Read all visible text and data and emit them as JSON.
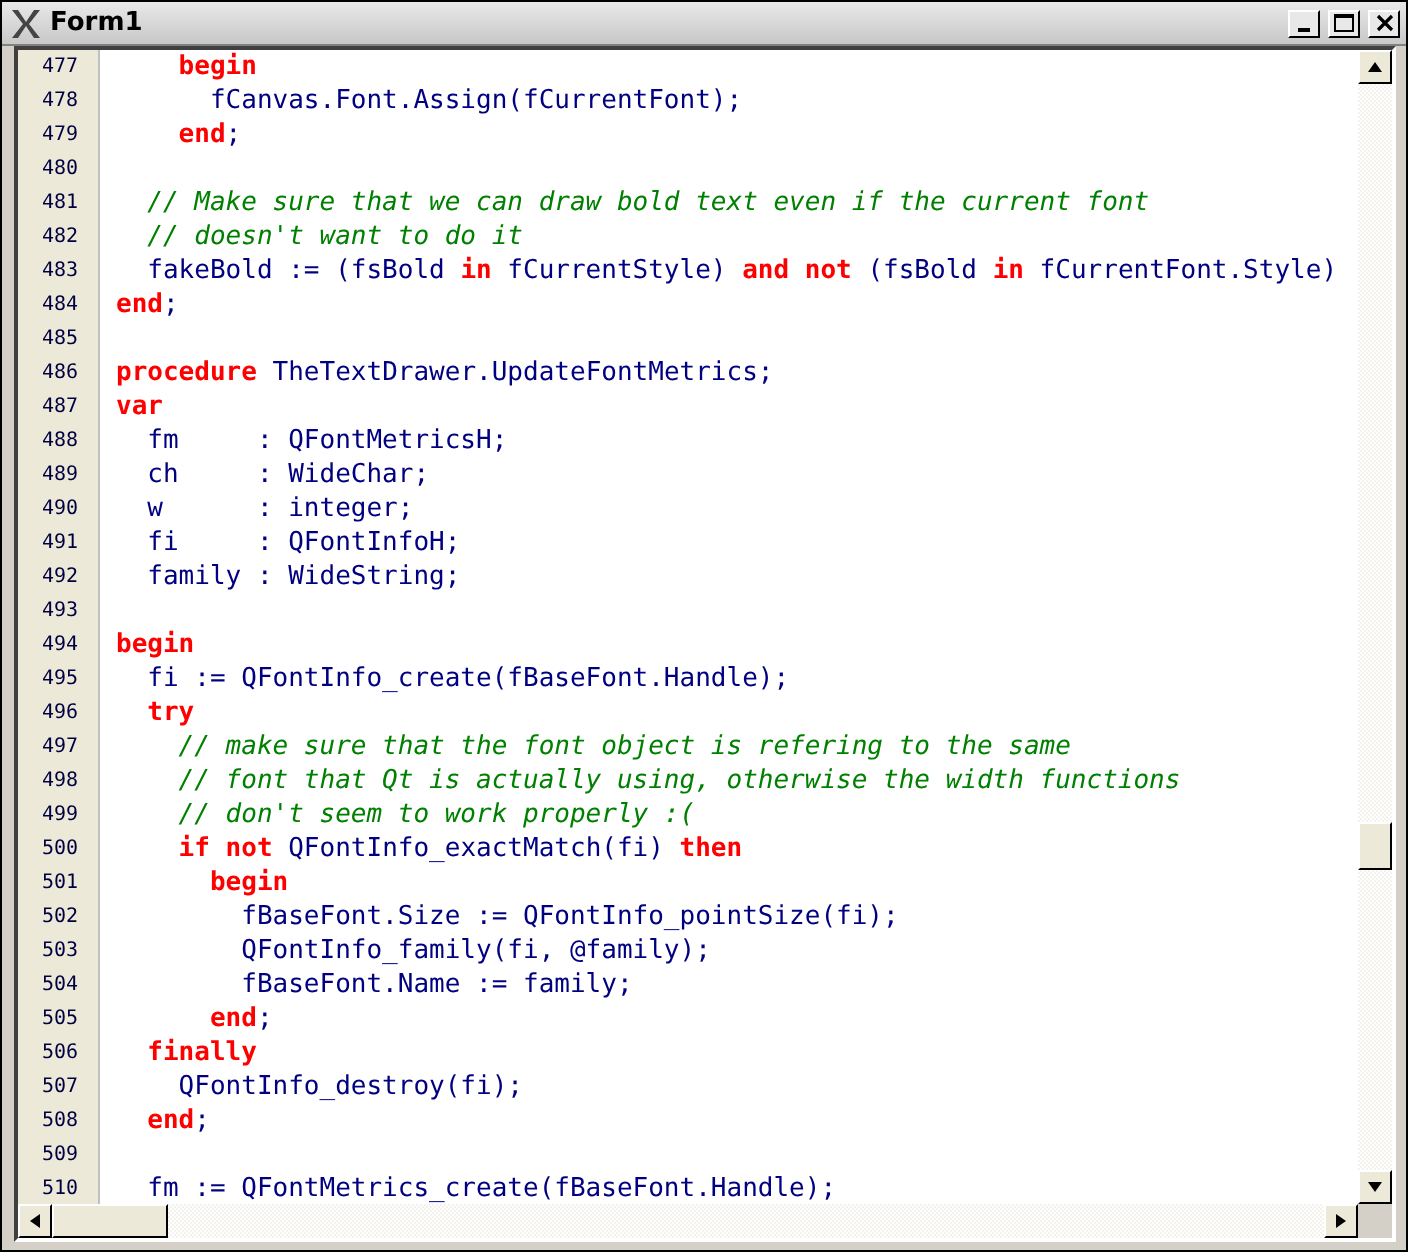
{
  "window": {
    "title": "Form1"
  },
  "editor": {
    "lines": [
      {
        "number": "477",
        "tokens": [
          {
            "kind": "keyword",
            "text": "    begin"
          }
        ]
      },
      {
        "number": "478",
        "tokens": [
          {
            "kind": "plain",
            "text": "      fCanvas.Font.Assign(fCurrentFont);"
          }
        ]
      },
      {
        "number": "479",
        "tokens": [
          {
            "kind": "keyword",
            "text": "    end"
          },
          {
            "kind": "plain",
            "text": ";"
          }
        ]
      },
      {
        "number": "480"
      },
      {
        "number": "481",
        "tokens": [
          {
            "kind": "comment",
            "text": "  // Make sure that we can draw bold text even if the current font"
          }
        ]
      },
      {
        "number": "482",
        "tokens": [
          {
            "kind": "comment",
            "text": "  // doesn't want to do it"
          }
        ]
      },
      {
        "number": "483",
        "tokens": [
          {
            "kind": "plain",
            "text": "  fakeBold := (fsBold "
          },
          {
            "kind": "keyword",
            "text": "in"
          },
          {
            "kind": "plain",
            "text": " fCurrentStyle) "
          },
          {
            "kind": "keyword",
            "text": "and not"
          },
          {
            "kind": "plain",
            "text": " (fsBold "
          },
          {
            "kind": "keyword",
            "text": "in"
          },
          {
            "kind": "plain",
            "text": " fCurrentFont.Style)"
          }
        ]
      },
      {
        "number": "484",
        "tokens": [
          {
            "kind": "keyword",
            "text": "end"
          },
          {
            "kind": "plain",
            "text": ";"
          }
        ]
      },
      {
        "number": "485"
      },
      {
        "number": "486",
        "tokens": [
          {
            "kind": "keyword",
            "text": "procedure"
          },
          {
            "kind": "plain",
            "text": " TheTextDrawer.UpdateFontMetrics;"
          }
        ]
      },
      {
        "number": "487",
        "tokens": [
          {
            "kind": "keyword",
            "text": "var"
          }
        ]
      },
      {
        "number": "488",
        "tokens": [
          {
            "kind": "plain",
            "text": "  fm     : QFontMetricsH;"
          }
        ]
      },
      {
        "number": "489",
        "tokens": [
          {
            "kind": "plain",
            "text": "  ch     : WideChar;"
          }
        ]
      },
      {
        "number": "490",
        "tokens": [
          {
            "kind": "plain",
            "text": "  w      : integer;"
          }
        ]
      },
      {
        "number": "491",
        "tokens": [
          {
            "kind": "plain",
            "text": "  fi     : QFontInfoH;"
          }
        ]
      },
      {
        "number": "492",
        "tokens": [
          {
            "kind": "plain",
            "text": "  family : WideString;"
          }
        ]
      },
      {
        "number": "493"
      },
      {
        "number": "494",
        "tokens": [
          {
            "kind": "keyword",
            "text": "begin"
          }
        ]
      },
      {
        "number": "495",
        "tokens": [
          {
            "kind": "plain",
            "text": "  fi := QFontInfo_create(fBaseFont.Handle);"
          }
        ]
      },
      {
        "number": "496",
        "tokens": [
          {
            "kind": "keyword",
            "text": "  try"
          }
        ]
      },
      {
        "number": "497",
        "tokens": [
          {
            "kind": "comment",
            "text": "    // make sure that the font object is refering to the same"
          }
        ]
      },
      {
        "number": "498",
        "tokens": [
          {
            "kind": "comment",
            "text": "    // font that Qt is actually using, otherwise the width functions"
          }
        ]
      },
      {
        "number": "499",
        "tokens": [
          {
            "kind": "comment",
            "text": "    // don't seem to work properly :("
          }
        ]
      },
      {
        "number": "500",
        "tokens": [
          {
            "kind": "keyword",
            "text": "    if not"
          },
          {
            "kind": "plain",
            "text": " QFontInfo_exactMatch(fi) "
          },
          {
            "kind": "keyword",
            "text": "then"
          }
        ]
      },
      {
        "number": "501",
        "tokens": [
          {
            "kind": "keyword",
            "text": "      begin"
          }
        ]
      },
      {
        "number": "502",
        "tokens": [
          {
            "kind": "plain",
            "text": "        fBaseFont.Size := QFontInfo_pointSize(fi);"
          }
        ]
      },
      {
        "number": "503",
        "tokens": [
          {
            "kind": "plain",
            "text": "        QFontInfo_family(fi, @family);"
          }
        ]
      },
      {
        "number": "504",
        "tokens": [
          {
            "kind": "plain",
            "text": "        fBaseFont.Name := family;"
          }
        ]
      },
      {
        "number": "505",
        "tokens": [
          {
            "kind": "keyword",
            "text": "      end"
          },
          {
            "kind": "plain",
            "text": ";"
          }
        ]
      },
      {
        "number": "506",
        "tokens": [
          {
            "kind": "keyword",
            "text": "  finally"
          }
        ]
      },
      {
        "number": "507",
        "tokens": [
          {
            "kind": "plain",
            "text": "    QFontInfo_destroy(fi);"
          }
        ]
      },
      {
        "number": "508",
        "tokens": [
          {
            "kind": "keyword",
            "text": "  end"
          },
          {
            "kind": "plain",
            "text": ";"
          }
        ]
      },
      {
        "number": "509"
      },
      {
        "number": "510",
        "tokens": [
          {
            "kind": "plain",
            "text": "  fm := QFontMetrics_create(fBaseFont.Handle);"
          }
        ]
      }
    ]
  }
}
